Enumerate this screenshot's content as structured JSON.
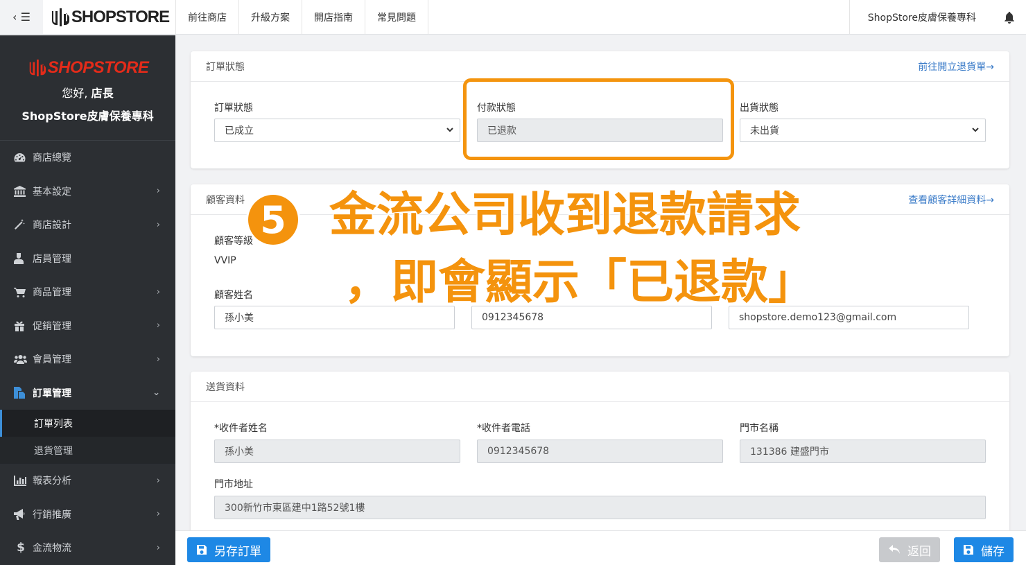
{
  "topbar": {
    "brand": "SHOPSTORE",
    "nav": [
      "前往商店",
      "升級方案",
      "開店指南",
      "常見問題"
    ],
    "store_name": "ShopStore皮膚保養專科"
  },
  "sidebar": {
    "brand": "SHOPSTORE",
    "greeting_prefix": "您好, ",
    "greeting_name": "店長",
    "store_name": "ShopStore皮膚保養專科",
    "items": [
      {
        "label": "商店總覽",
        "icon": "dashboard-icon"
      },
      {
        "label": "基本設定",
        "icon": "bank-icon"
      },
      {
        "label": "商店設計",
        "icon": "magic-wand-icon"
      },
      {
        "label": "店員管理",
        "icon": "staff-icon"
      },
      {
        "label": "商品管理",
        "icon": "cart-icon"
      },
      {
        "label": "促銷管理",
        "icon": "gift-icon"
      },
      {
        "label": "會員管理",
        "icon": "users-icon"
      },
      {
        "label": "訂單管理",
        "icon": "copy-icon"
      },
      {
        "label": "報表分析",
        "icon": "bar-chart-icon"
      },
      {
        "label": "行銷推廣",
        "icon": "megaphone-icon"
      },
      {
        "label": "金流物流",
        "icon": "dollar-icon"
      }
    ],
    "subitems": [
      "訂單列表",
      "退貨管理"
    ]
  },
  "order_status": {
    "title": "訂單狀態",
    "link": "前往開立退貨單→",
    "order_label": "訂單狀態",
    "order_value": "已成立",
    "payment_label": "付款狀態",
    "payment_value": "已退款",
    "shipping_label": "出貨狀態",
    "shipping_value": "未出貨"
  },
  "customer": {
    "title": "顧客資料",
    "link": "查看顧客詳細資料→",
    "level_label": "顧客等級",
    "level_value": "VVIP",
    "name_label": "顧客姓名",
    "name_value": "孫小美",
    "phone_value": "0912345678",
    "email_value": "shopstore.demo123@gmail.com"
  },
  "delivery": {
    "title": "送貨資料",
    "recipient_label": "*收件者姓名",
    "recipient_value": "孫小美",
    "phone_label": "*收件者電話",
    "phone_value": "0912345678",
    "store_label": "門市名稱",
    "store_value": "131386 建盛門市",
    "address_label": "門市地址",
    "address_value": "300新竹市東區建中1路52號1樓"
  },
  "annotation": {
    "step": "5",
    "line1": "金流公司收到退款請求",
    "line2": "，即會顯示「已退款」",
    "color": "#f4930d"
  },
  "actions": {
    "save_as": "另存訂單",
    "back": "返回",
    "save": "儲存"
  },
  "colors": {
    "primary": "#1e88e5",
    "sidebar_bg": "#2c2f33",
    "link": "#3a7bc8",
    "highlight": "#f4940e"
  }
}
